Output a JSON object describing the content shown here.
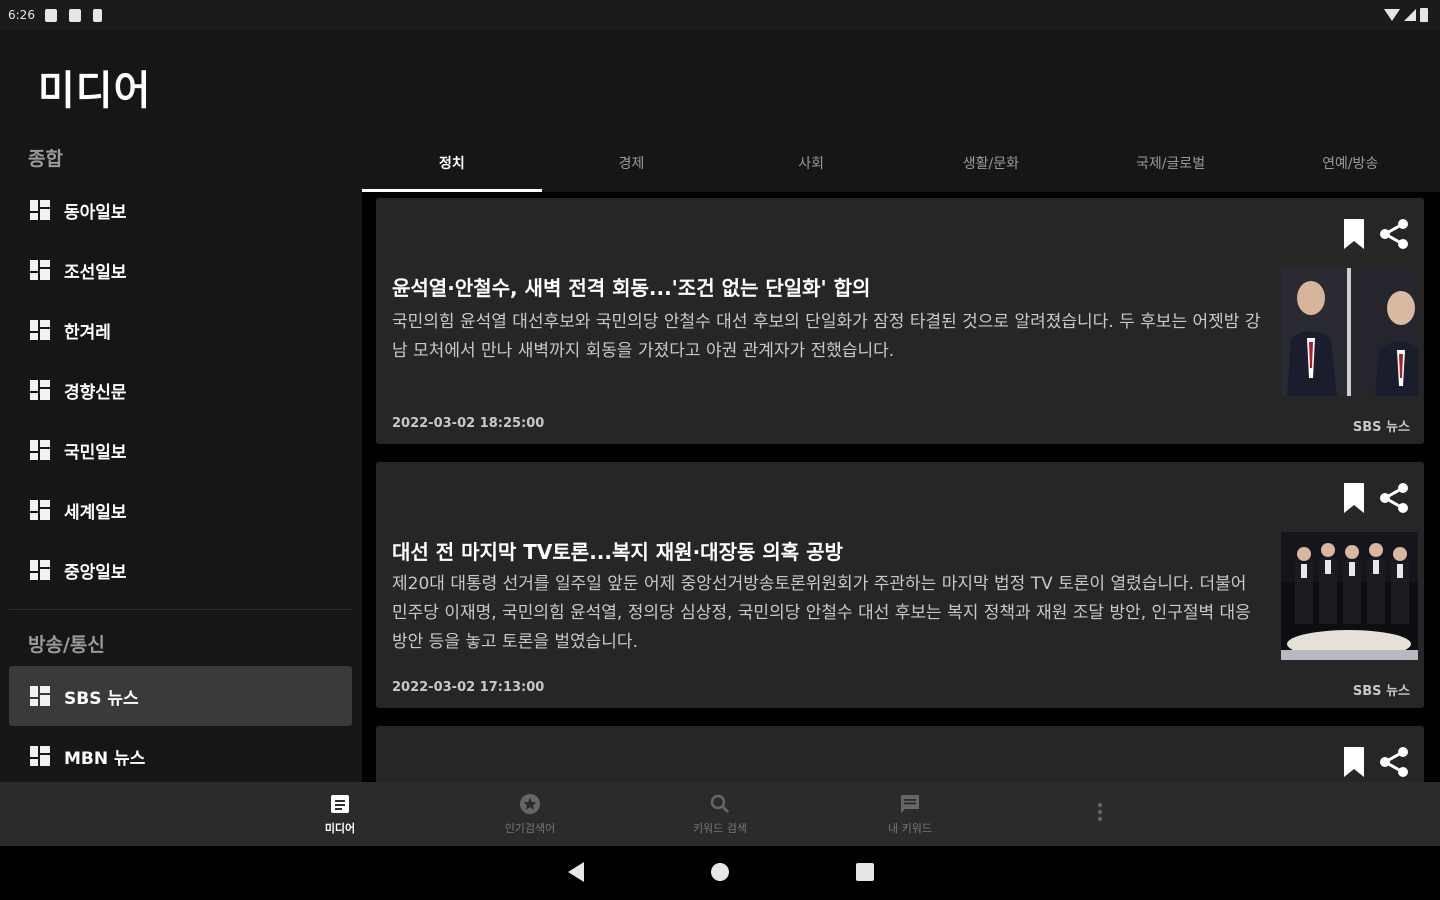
{
  "status_bar": {
    "time": "6:26"
  },
  "app": {
    "title": "미디어"
  },
  "sidebar": {
    "sections": [
      {
        "label": "종합",
        "items": [
          {
            "label": "동아일보"
          },
          {
            "label": "조선일보"
          },
          {
            "label": "한겨레"
          },
          {
            "label": "경향신문"
          },
          {
            "label": "국민일보"
          },
          {
            "label": "세계일보"
          },
          {
            "label": "중앙일보"
          }
        ]
      },
      {
        "label": "방송/통신",
        "items": [
          {
            "label": "SBS 뉴스",
            "selected": true
          },
          {
            "label": "MBN 뉴스"
          }
        ]
      }
    ]
  },
  "tabs": [
    {
      "label": "정치",
      "active": true
    },
    {
      "label": "경제"
    },
    {
      "label": "사회"
    },
    {
      "label": "생활/문화"
    },
    {
      "label": "국제/글로벌"
    },
    {
      "label": "연예/방송"
    }
  ],
  "articles": [
    {
      "title": "윤석열·안철수, 새벽 전격 회동...'조건 없는 단일화' 합의",
      "summary": "국민의힘 윤석열 대선후보와 국민의당 안철수 대선 후보의 단일화가 잠정 타결된 것으로 알려졌습니다. 두 후보는 어젯밤 강남 모처에서 만나 새벽까지 회동을 가졌다고 야권 관계자가 전했습니다.",
      "date": "2022-03-02 18:25:00",
      "source": "SBS 뉴스"
    },
    {
      "title": "대선 전 마지막 TV토론...복지 재원·대장동 의혹 공방",
      "summary": "제20대 대통령 선거를 일주일 앞둔 어제 중앙선거방송토론위원회가 주관하는 마지막 법정 TV 토론이 열렸습니다. 더불어민주당 이재명, 국민의힘 윤석열, 정의당 심상정, 국민의당 안철수 대선 후보는 복지 정책과 재원 조달 방안, 인구절벽 대응 방안 등을 놓고 토론을 벌였습니다.",
      "date": "2022-03-02 17:13:00",
      "source": "SBS 뉴스"
    }
  ],
  "bottom_nav": [
    {
      "label": "미디어",
      "icon": "article-icon",
      "active": true
    },
    {
      "label": "인기검색어",
      "icon": "star-icon"
    },
    {
      "label": "키워드 검색",
      "icon": "search-icon"
    },
    {
      "label": "내 키워드",
      "icon": "chat-icon"
    },
    {
      "label": "",
      "icon": "more-vert-icon"
    }
  ]
}
